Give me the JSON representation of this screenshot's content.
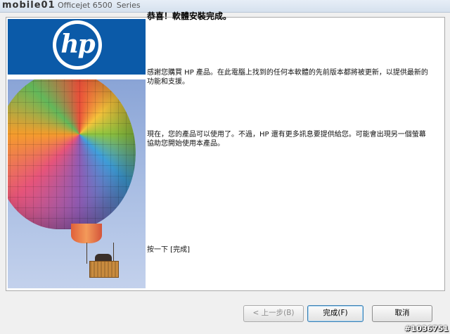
{
  "window": {
    "watermark_logo": "mobile01",
    "title_prefix": "Officejet 6500",
    "title_suffix": "Series"
  },
  "brand": {
    "logo_text": "hp",
    "logo_color": "#0b5aa8"
  },
  "content": {
    "heading": "恭喜！軟體安裝完成。",
    "paragraph1": "感謝您購買 HP 產品。在此電腦上找到的任何本軟體的先前版本都將被更新，以提供最新的功能和支援。",
    "paragraph2": "現在，您的產品可以使用了。不過，HP 還有更多訊息要提供給您。可能會出現另一個螢幕協助您開始使用本產品。",
    "instruction": "按一下 [完成]"
  },
  "buttons": {
    "back": "< 上一步(B)",
    "finish": "完成(F)",
    "cancel": "取消"
  },
  "footer": {
    "watermark_id": "#1036751"
  }
}
